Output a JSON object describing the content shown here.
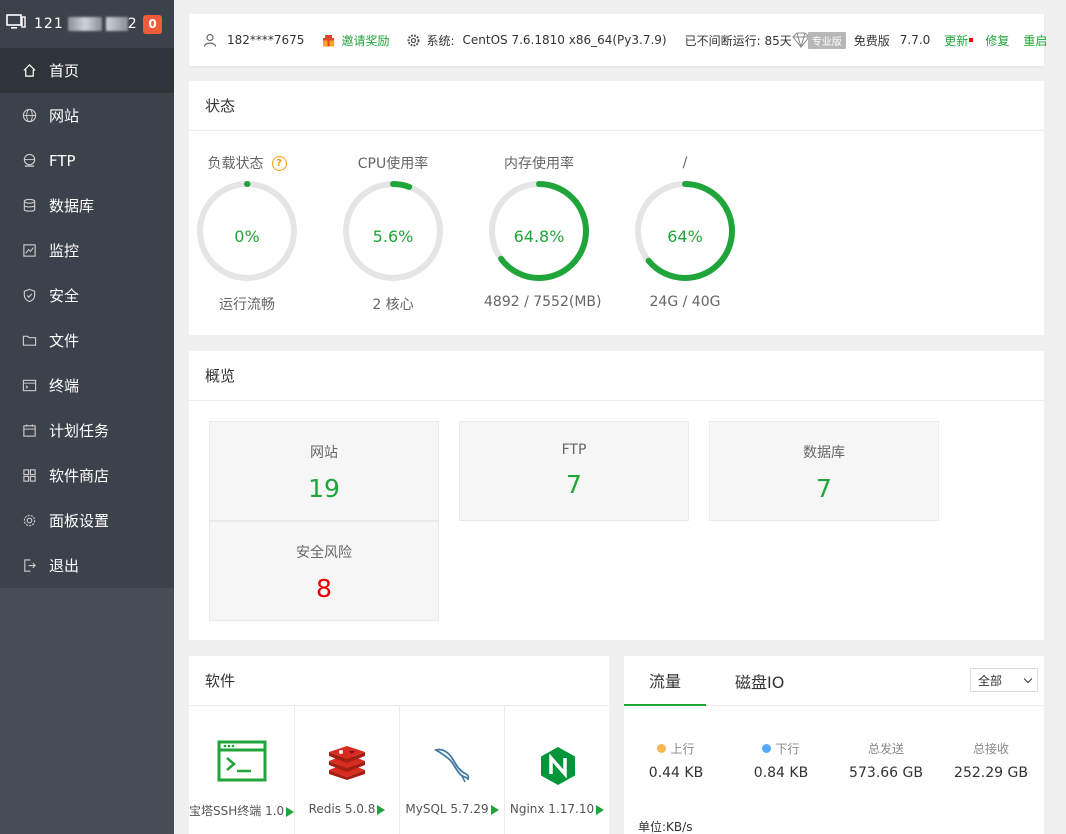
{
  "sidebar": {
    "ip_prefix": "121",
    "ip_suffix": "2",
    "badge": "0",
    "items": [
      {
        "label": "首页",
        "icon": "home-icon"
      },
      {
        "label": "网站",
        "icon": "globe-icon"
      },
      {
        "label": "FTP",
        "icon": "ftp-icon"
      },
      {
        "label": "数据库",
        "icon": "database-icon"
      },
      {
        "label": "监控",
        "icon": "monitor-icon"
      },
      {
        "label": "安全",
        "icon": "shield-icon"
      },
      {
        "label": "文件",
        "icon": "folder-icon"
      },
      {
        "label": "终端",
        "icon": "terminal-icon"
      },
      {
        "label": "计划任务",
        "icon": "calendar-icon"
      },
      {
        "label": "软件商店",
        "icon": "grid-icon"
      },
      {
        "label": "面板设置",
        "icon": "gear-icon"
      },
      {
        "label": "退出",
        "icon": "logout-icon"
      }
    ]
  },
  "header": {
    "user": "182****7675",
    "invite": "邀请奖励",
    "system_label": "系统:",
    "system_value": "CentOS 7.6.1810 x86_64(Py3.7.9)",
    "uptime": "已不间断运行: 85天",
    "pro_tag": "专业版",
    "edition": "免费版",
    "version": "7.7.0",
    "update": "更新",
    "repair": "修复",
    "restart": "重启"
  },
  "status": {
    "title": "状态",
    "gauges": [
      {
        "title": "负载状态",
        "value": "0%",
        "sub": "运行流畅",
        "percent": 0,
        "help": "?"
      },
      {
        "title": "CPU使用率",
        "value": "5.6%",
        "sub": "2 核心",
        "percent": 5.6
      },
      {
        "title": "内存使用率",
        "value": "64.8%",
        "sub": "4892 / 7552(MB)",
        "percent": 64.8
      },
      {
        "title": "/",
        "value": "64%",
        "sub": "24G / 40G",
        "percent": 64
      }
    ]
  },
  "overview": {
    "title": "概览",
    "cards": [
      {
        "label": "网站",
        "value": "19"
      },
      {
        "label": "FTP",
        "value": "7"
      },
      {
        "label": "数据库",
        "value": "7"
      },
      {
        "label": "安全风险",
        "value": "8"
      }
    ]
  },
  "software": {
    "title": "软件",
    "items": [
      {
        "name": "宝塔SSH终端 1.0"
      },
      {
        "name": "Redis 5.0.8"
      },
      {
        "name": "MySQL 5.7.29"
      },
      {
        "name": "Nginx 1.17.10"
      }
    ]
  },
  "traffic": {
    "tabs": [
      "流量",
      "磁盘IO"
    ],
    "select": "全部",
    "cols": [
      {
        "label": "上行",
        "value": "0.44 KB",
        "color": "#f7b851"
      },
      {
        "label": "下行",
        "value": "0.84 KB",
        "color": "#52a9ff"
      },
      {
        "label": "总发送",
        "value": "573.66 GB"
      },
      {
        "label": "总接收",
        "value": "252.29 GB"
      }
    ],
    "unit": "单位:KB/s"
  },
  "colors": {
    "accent": "#20a53a",
    "danger": "#ef0000",
    "sidebar": "#3c424b"
  }
}
